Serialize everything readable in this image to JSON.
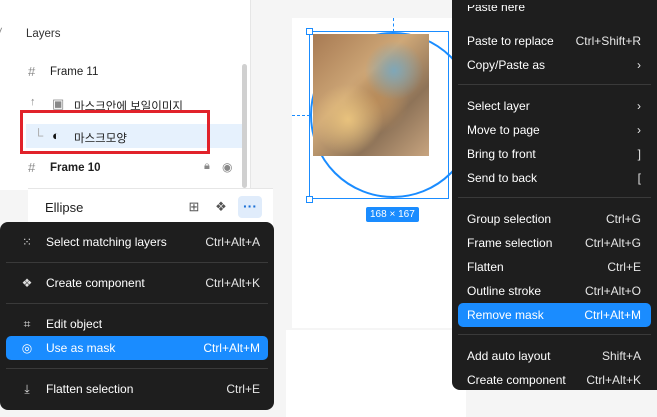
{
  "layers": {
    "header": "Layers",
    "rows": [
      {
        "label": "Frame 11"
      },
      {
        "label": "마스크안에 보일이미지"
      },
      {
        "label": "마스크모양"
      },
      {
        "label": "Frame 10"
      }
    ]
  },
  "properties": {
    "title": "Ellipse",
    "more_label": "···"
  },
  "canvas": {
    "dimension_badge": "168 × 167"
  },
  "left_menu": {
    "items": [
      {
        "label": "Select matching layers",
        "shortcut": "Ctrl+Alt+A"
      },
      {
        "label": "Create component",
        "shortcut": "Ctrl+Alt+K"
      },
      {
        "label": "Edit object",
        "shortcut": ""
      },
      {
        "label": "Use as mask",
        "shortcut": "Ctrl+Alt+M"
      },
      {
        "label": "Flatten selection",
        "shortcut": "Ctrl+E"
      }
    ]
  },
  "right_menu": {
    "items": [
      {
        "label": "Paste here",
        "shortcut": ""
      },
      {
        "label": "Paste to replace",
        "shortcut": "Ctrl+Shift+R"
      },
      {
        "label": "Copy/Paste as",
        "shortcut": "›"
      },
      {
        "label": "Select layer",
        "shortcut": "›"
      },
      {
        "label": "Move to page",
        "shortcut": "›"
      },
      {
        "label": "Bring to front",
        "shortcut": "]"
      },
      {
        "label": "Send to back",
        "shortcut": "["
      },
      {
        "label": "Group selection",
        "shortcut": "Ctrl+G"
      },
      {
        "label": "Frame selection",
        "shortcut": "Ctrl+Alt+G"
      },
      {
        "label": "Flatten",
        "shortcut": "Ctrl+E"
      },
      {
        "label": "Outline stroke",
        "shortcut": "Ctrl+Alt+O"
      },
      {
        "label": "Remove mask",
        "shortcut": "Ctrl+Alt+M"
      },
      {
        "label": "Add auto layout",
        "shortcut": "Shift+A"
      },
      {
        "label": "Create component",
        "shortcut": "Ctrl+Alt+K"
      }
    ]
  },
  "colors": {
    "accent": "#1a8cff",
    "highlight": "#e1222a",
    "menu_bg": "#1e1e1e"
  }
}
